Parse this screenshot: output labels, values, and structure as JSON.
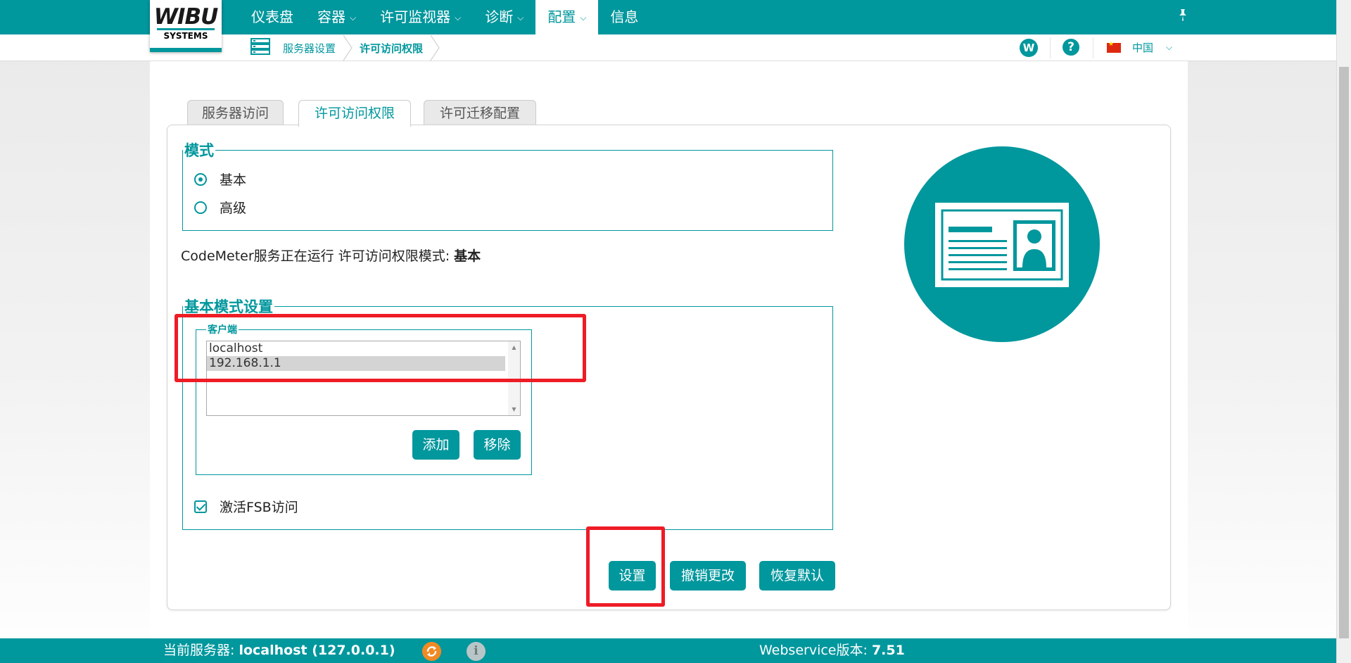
{
  "logo": {
    "main": "WIBU",
    "sub": "SYSTEMS"
  },
  "nav": {
    "items": [
      {
        "label": "仪表盘"
      },
      {
        "label": "容器"
      },
      {
        "label": "许可监视器"
      },
      {
        "label": "诊断"
      },
      {
        "label": "配置"
      },
      {
        "label": "信息"
      }
    ]
  },
  "breadcrumb": {
    "items": [
      "服务器设置",
      "许可访问权限"
    ]
  },
  "header_right": {
    "w_badge": "W",
    "help": "?",
    "language": "中国"
  },
  "tabs": [
    "服务器访问",
    "许可访问权限",
    "许可迁移配置"
  ],
  "mode": {
    "legend": "模式",
    "options": [
      "基本",
      "高级"
    ],
    "selected": "基本"
  },
  "status": {
    "text": "CodeMeter服务正在运行 许可访问权限模式: ",
    "mode_value": "基本"
  },
  "basic_settings": {
    "legend": "基本模式设置",
    "clients_legend": "客户端",
    "clients": [
      "localhost",
      "192.168.1.1"
    ],
    "selected_client": "192.168.1.1",
    "add_button": "添加",
    "remove_button": "移除",
    "fsb_label": "激活FSB访问",
    "fsb_checked": true
  },
  "actions": {
    "set": "设置",
    "undo": "撤销更改",
    "restore": "恢复默认"
  },
  "footer": {
    "server_label": "当前服务器: ",
    "server_value": "localhost (127.0.0.1)",
    "version_label": "Webservice版本: ",
    "version_value": "7.51"
  },
  "colors": {
    "accent": "#00979d",
    "highlight": "#ee1c25",
    "sync": "#f08a24"
  }
}
